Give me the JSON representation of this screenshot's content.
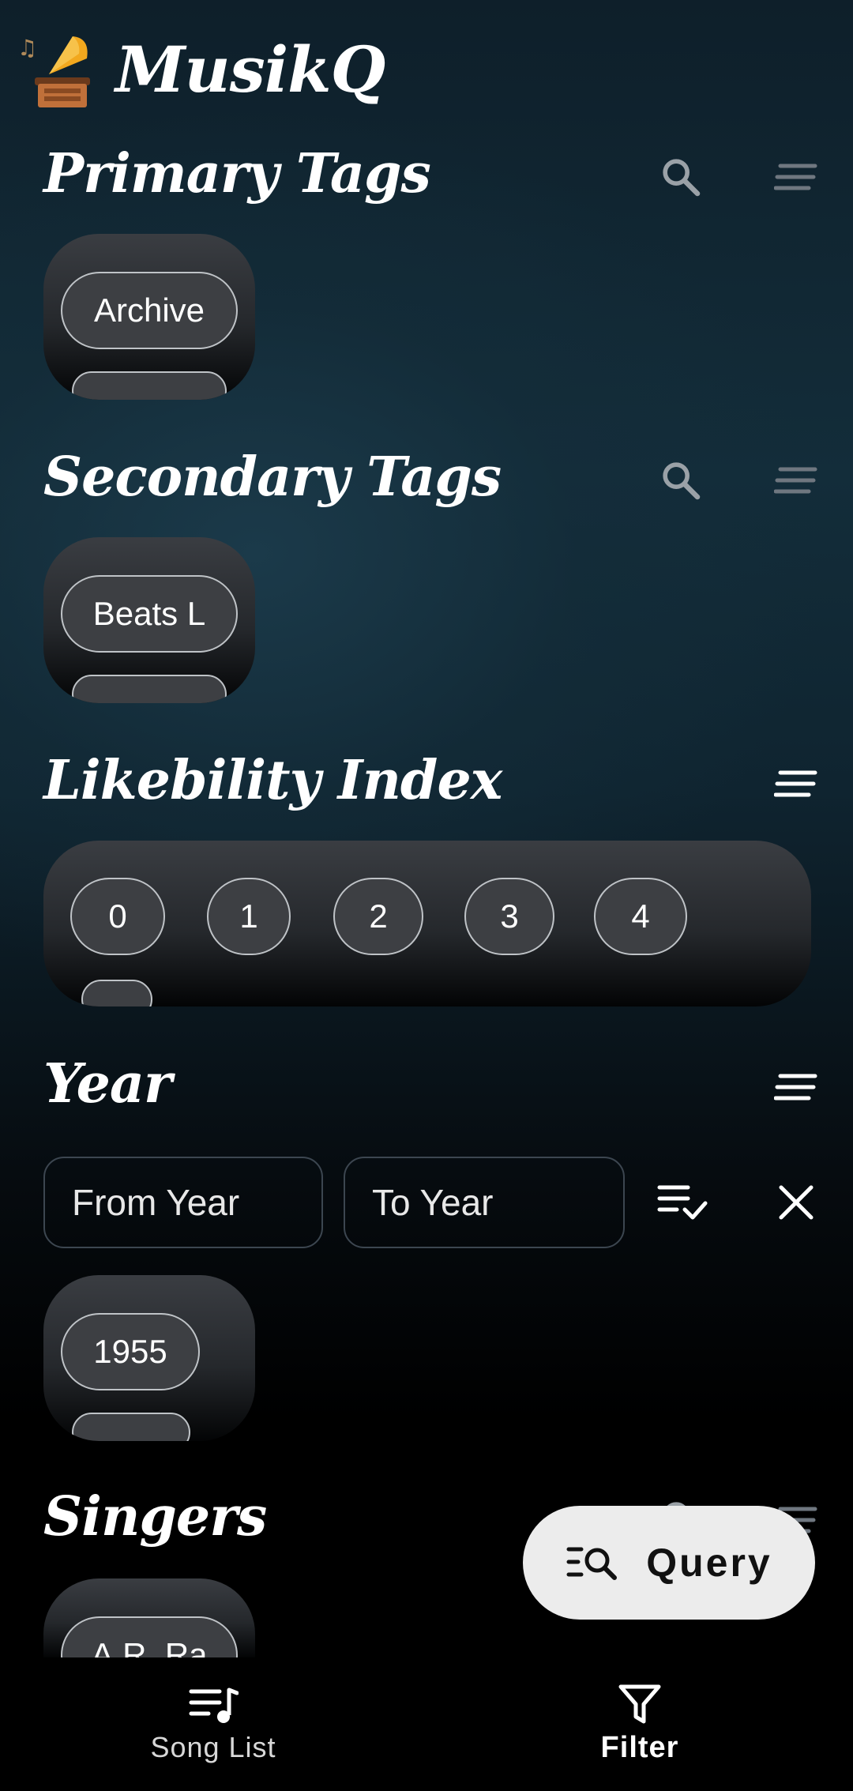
{
  "app": {
    "title": "MusikQ"
  },
  "primary_tags": {
    "title": "Primary Tags",
    "chips": [
      "Archive"
    ]
  },
  "secondary_tags": {
    "title": "Secondary Tags",
    "chips": [
      "Beats L"
    ]
  },
  "likebility": {
    "title": "Likebility Index",
    "chips": [
      "0",
      "1",
      "2",
      "3",
      "4"
    ]
  },
  "year": {
    "title": "Year",
    "from_placeholder": "From Year",
    "to_placeholder": "To Year",
    "chips": [
      "1955"
    ]
  },
  "singers": {
    "title": "Singers",
    "chips": [
      "A.R. Ra"
    ]
  },
  "fab": {
    "label": "Query"
  },
  "bottom_nav": {
    "song_list": "Song List",
    "filter": "Filter",
    "active": "filter"
  },
  "colors": {
    "background_top": "#132d3a",
    "background_bottom": "#000000",
    "chip_bg": "#3d3f43",
    "fab_bg": "#ececec"
  },
  "icons": {
    "logo": "gramophone-icon",
    "search": "search-icon",
    "sort": "sort-icon",
    "apply": "playlist-check-icon",
    "clear": "close-icon",
    "query": "search-list-icon",
    "song_list": "music-list-icon",
    "filter": "filter-icon"
  }
}
